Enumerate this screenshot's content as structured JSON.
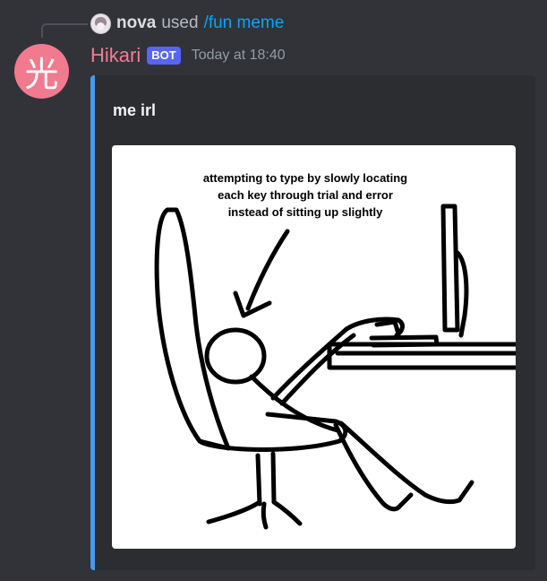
{
  "reply": {
    "username": "nova",
    "used_text": "used",
    "command": "/fun meme"
  },
  "avatar": {
    "glyph": "光",
    "color": "#f17a8f"
  },
  "header": {
    "username": "Hikari",
    "bot_tag": "BOT",
    "timestamp": "Today at 18:40"
  },
  "embed": {
    "accent_color": "#449af0",
    "title": "me irl",
    "image": {
      "caption_lines": [
        "attempting to type by slowly locating",
        "each key through trial and error",
        "instead of sitting up slightly"
      ]
    }
  }
}
